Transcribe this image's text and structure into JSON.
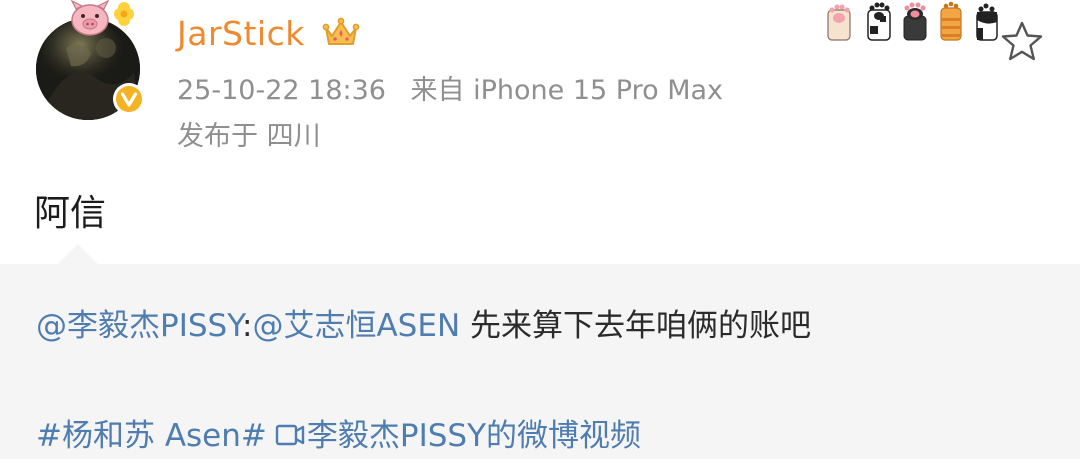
{
  "user": {
    "name": "JarStick"
  },
  "meta": {
    "time": "25-10-22 18:36",
    "source_prefix": "来自",
    "device": "iPhone 15 Pro Max",
    "location": "发布于 四川"
  },
  "post": {
    "text": "阿信"
  },
  "repost": {
    "mention_user": "@李毅杰PISSY",
    "colon": ":",
    "mention_target": "@艾志恒ASEN",
    "message": " 先来算下去年咱俩的账吧",
    "hashtag": "#杨和苏 Asen#",
    "video_link": "李毅杰PISSY的微博视频"
  },
  "icons": {
    "avatar_decoration": "pig-icon",
    "verified": "verified-badge-icon",
    "crown": "crown-icon",
    "paws": "paw-icons",
    "favorite": "star-icon",
    "video": "video-icon"
  },
  "colors": {
    "username": "#ef8a2e",
    "meta": "#8f8f8f",
    "link": "#507daf",
    "repost_bg": "#f5f5f5",
    "verified": "#f5b323"
  }
}
